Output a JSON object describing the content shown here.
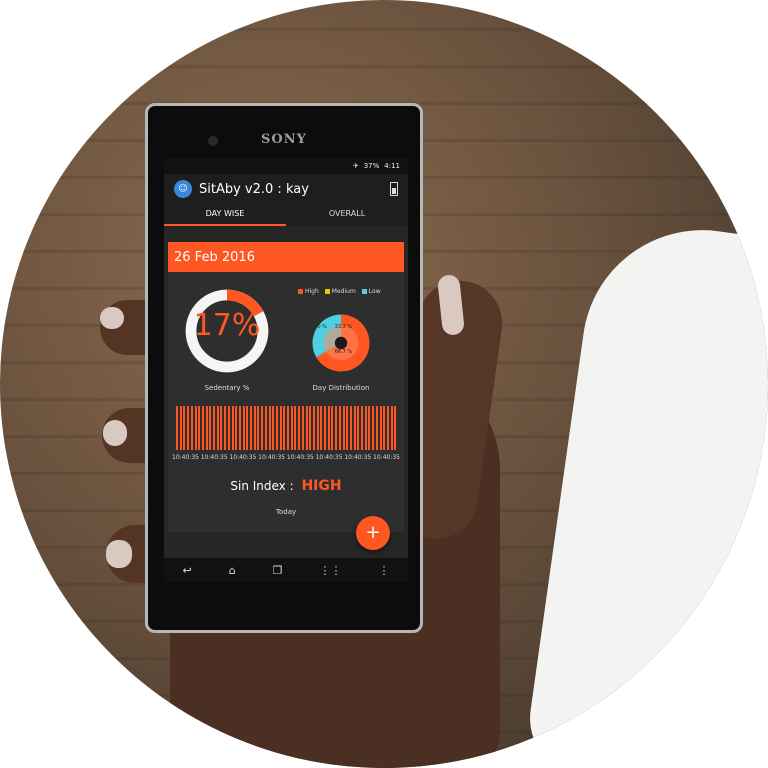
{
  "device": {
    "brand": "SONY"
  },
  "status_bar": {
    "battery": "37%",
    "time": "4:11"
  },
  "app": {
    "title": "SitAby v2.0 : kay"
  },
  "tabs": [
    {
      "label": "DAY WISE",
      "active": true
    },
    {
      "label": "OVERALL",
      "active": false
    }
  ],
  "card": {
    "date": "26 Feb 2016",
    "sedentary": {
      "value": "17%",
      "fraction": 0.17,
      "label": "Sedentary %"
    },
    "legend": [
      {
        "label": "High",
        "color": "#ff5722"
      },
      {
        "label": "Medium",
        "color": "#f4c20d"
      },
      {
        "label": "Low",
        "color": "#4dd0e1"
      }
    ],
    "distribution": {
      "label": "Day Distribution",
      "slices": [
        {
          "name": "High",
          "value": 66.7,
          "text": "66.7 %",
          "color": "#ff5722"
        },
        {
          "name": "Medium",
          "value": 0.0,
          "text": "0 %",
          "color": "#f4c20d"
        },
        {
          "name": "Low",
          "value": 33.3,
          "text": "33.3 %",
          "color": "#4dd0e1"
        }
      ]
    },
    "timeline": {
      "bar_count": 60,
      "tick_labels": [
        "10:40:35",
        "10:40:35",
        "10:40:35",
        "10:40:35",
        "10:40:35",
        "10:40:35",
        "10:40:35",
        "10:40:35"
      ]
    },
    "sin_index": {
      "label": "Sin Index :",
      "value": "HIGH"
    },
    "footer": "Today"
  },
  "fab_label": "+",
  "nav": {
    "back": "↩",
    "home": "⌂",
    "recents": "❐",
    "apps": "⋮⋮",
    "menu": "⋮"
  },
  "colors": {
    "accent": "#ff5722",
    "background": "#262626"
  }
}
